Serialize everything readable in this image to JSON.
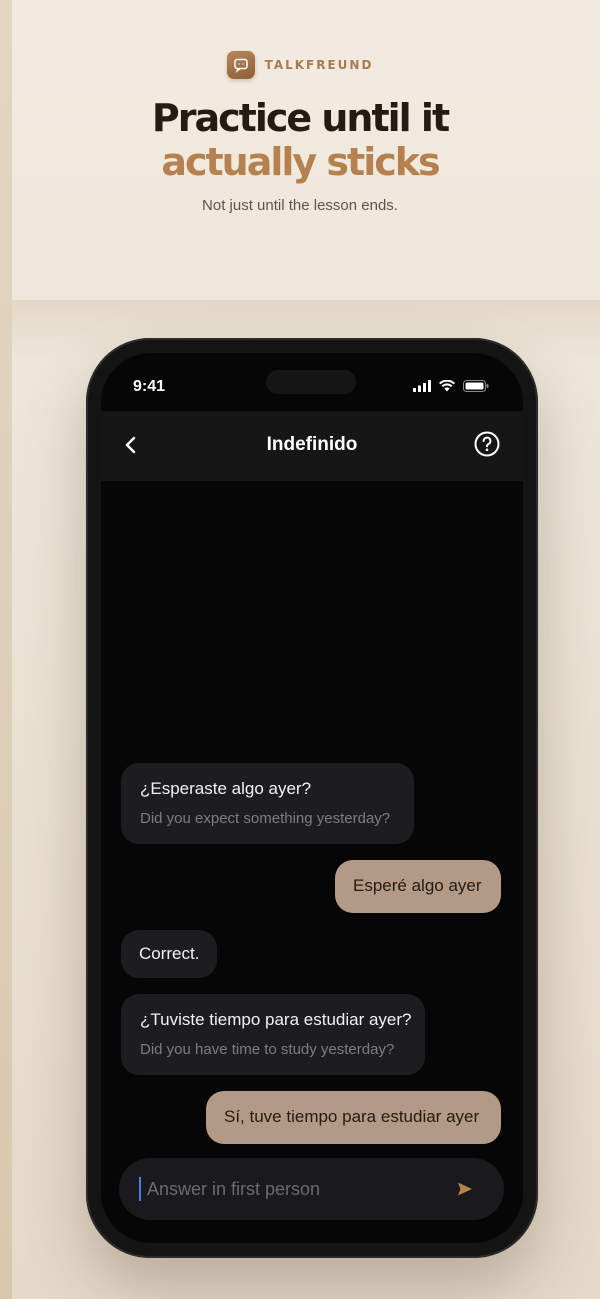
{
  "brand": {
    "name": "TALKFREUND",
    "logo_icon": "chat-bubble-icon"
  },
  "headline": {
    "line1": "Practice until it",
    "line2": "actually sticks"
  },
  "subhead": "Not just until the lesson ends.",
  "colors": {
    "accent": "#b5824f",
    "user_bubble": "#b39a86",
    "bot_bubble": "#1d1d20"
  },
  "status_bar": {
    "time": "9:41",
    "icons": [
      "signal-icon",
      "wifi-icon",
      "battery-icon"
    ]
  },
  "navbar": {
    "title": "Indefinido",
    "back_icon": "chevron-left-icon",
    "help_icon": "help-circle-icon"
  },
  "messages": [
    {
      "from": "bot",
      "text": "¿Esperaste algo ayer?",
      "translation": "Did you expect something yesterday?"
    },
    {
      "from": "user",
      "text": "Esperé algo ayer"
    },
    {
      "from": "bot",
      "text": "Correct."
    },
    {
      "from": "bot",
      "text": "¿Tuviste tiempo para estudiar ayer?",
      "translation": "Did you have time to study yesterday?"
    },
    {
      "from": "user",
      "text": "Sí, tuve tiempo para estudiar ayer"
    }
  ],
  "composer": {
    "placeholder": "Answer in first person",
    "send_icon": "send-icon"
  }
}
